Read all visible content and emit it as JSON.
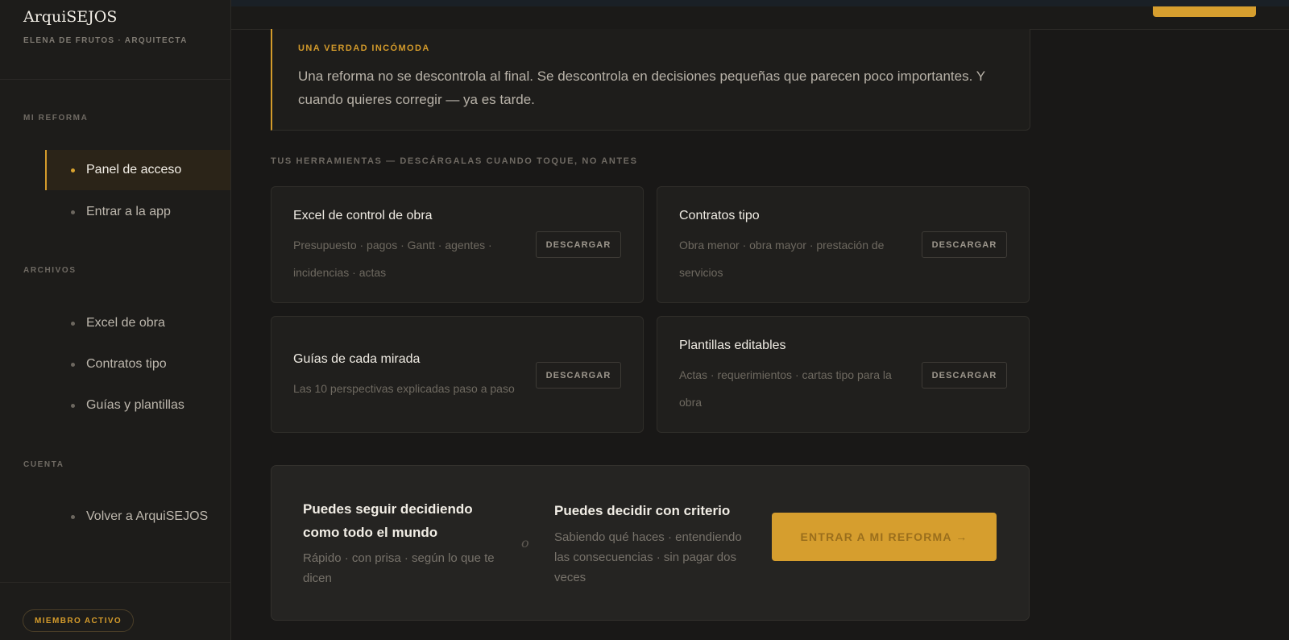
{
  "brand": {
    "name": "ArquiSEJOS",
    "subtitle": "ELENA DE FRUTOS · ARQUITECTA"
  },
  "sidebar": {
    "sections": [
      {
        "label": "MI REFORMA",
        "items": [
          {
            "label": "Panel de acceso",
            "active": true
          },
          {
            "label": "Entrar a la app",
            "active": false
          }
        ]
      },
      {
        "label": "ARCHIVOS",
        "items": [
          {
            "label": "Excel de obra"
          },
          {
            "label": "Contratos tipo"
          },
          {
            "label": "Guías y plantillas"
          }
        ]
      },
      {
        "label": "CUENTA",
        "items": [
          {
            "label": "Volver a ArquiSEJOS"
          }
        ]
      }
    ],
    "badge": "MIEMBRO ACTIVO"
  },
  "callout": {
    "kicker": "UNA VERDAD INCÓMODA",
    "text": "Una reforma no se descontrola al final. Se descontrola en decisiones pequeñas que parecen poco importantes. Y cuando quieres corregir — ya es tarde."
  },
  "tools": {
    "title": "TUS HERRAMIENTAS — DESCÁRGALAS CUANDO TOQUE, NO ANTES",
    "cards": [
      {
        "title": "Excel de control de obra",
        "desc": "Presupuesto · pagos · Gantt · agentes · incidencias · actas",
        "button": "DESCARGAR"
      },
      {
        "title": "Contratos tipo",
        "desc": "Obra menor · obra mayor · prestación de servicios",
        "button": "DESCARGAR"
      },
      {
        "title": "Guías de cada mirada",
        "desc": "Las 10 perspectivas explicadas paso a paso",
        "button": "DESCARGAR"
      },
      {
        "title": "Plantillas editables",
        "desc": "Actas · requerimientos · cartas tipo para la obra",
        "button": "DESCARGAR"
      }
    ]
  },
  "decision": {
    "left": {
      "title": "Puedes seguir decidiendo como todo el mundo",
      "desc": "Rápido · con prisa · según lo que te dicen"
    },
    "or": "o",
    "right": {
      "title": "Puedes decidir con criterio",
      "desc": "Sabiendo qué haces · entendiendo las consecuencias · sin pagar dos veces"
    },
    "cta": "ENTRAR A MI REFORMA →"
  },
  "colors": {
    "accent": "#d69e2e",
    "background": "#191817",
    "sidebar": "#1d1c1a"
  }
}
